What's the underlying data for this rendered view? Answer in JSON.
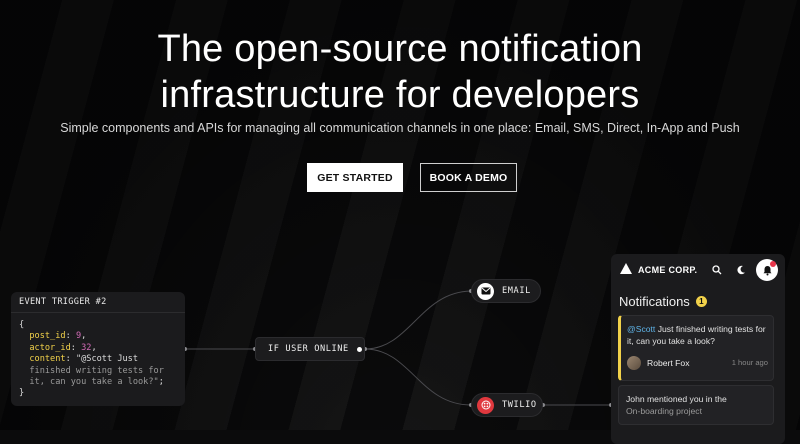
{
  "hero": {
    "title_line1": "The open-source notification",
    "title_line2": "infrastructure for developers",
    "subtitle": "Simple components and APIs for managing all communication channels in one place: Email, SMS, Direct, In-App and Push",
    "cta_primary": "GET STARTED",
    "cta_secondary": "BOOK A DEMO"
  },
  "event_card": {
    "title": "EVENT TRIGGER #2",
    "open_brace": "{",
    "close_brace": "}",
    "post_id_key": "post_id",
    "post_id_value": "9",
    "actor_id_key": "actor_id",
    "actor_id_value": "32",
    "content_key": "content",
    "content_line1": "\"@Scott Just",
    "content_line2": "finished writing tests for",
    "content_line3": "it, can you take a look?\""
  },
  "workflow": {
    "condition_label": "IF USER ONLINE",
    "email_label": "EMAIL",
    "twilio_label": "TWILIO"
  },
  "inbox": {
    "brand": "ACME CORP.",
    "title": "Notifications",
    "unread_count": "1",
    "notifications": [
      {
        "mention": "@Scott",
        "text": " Just finished writing tests for it, can you take a look?",
        "author": "Robert Fox",
        "time": "1 hour ago"
      },
      {
        "line1": "John mentioned you in the",
        "line2": "On-boarding project"
      }
    ]
  },
  "colors": {
    "accent_yellow": "#f2d24a",
    "mention_blue": "#5fb4e8",
    "twilio_red": "#e0383e",
    "background": "#0b0b0c"
  }
}
